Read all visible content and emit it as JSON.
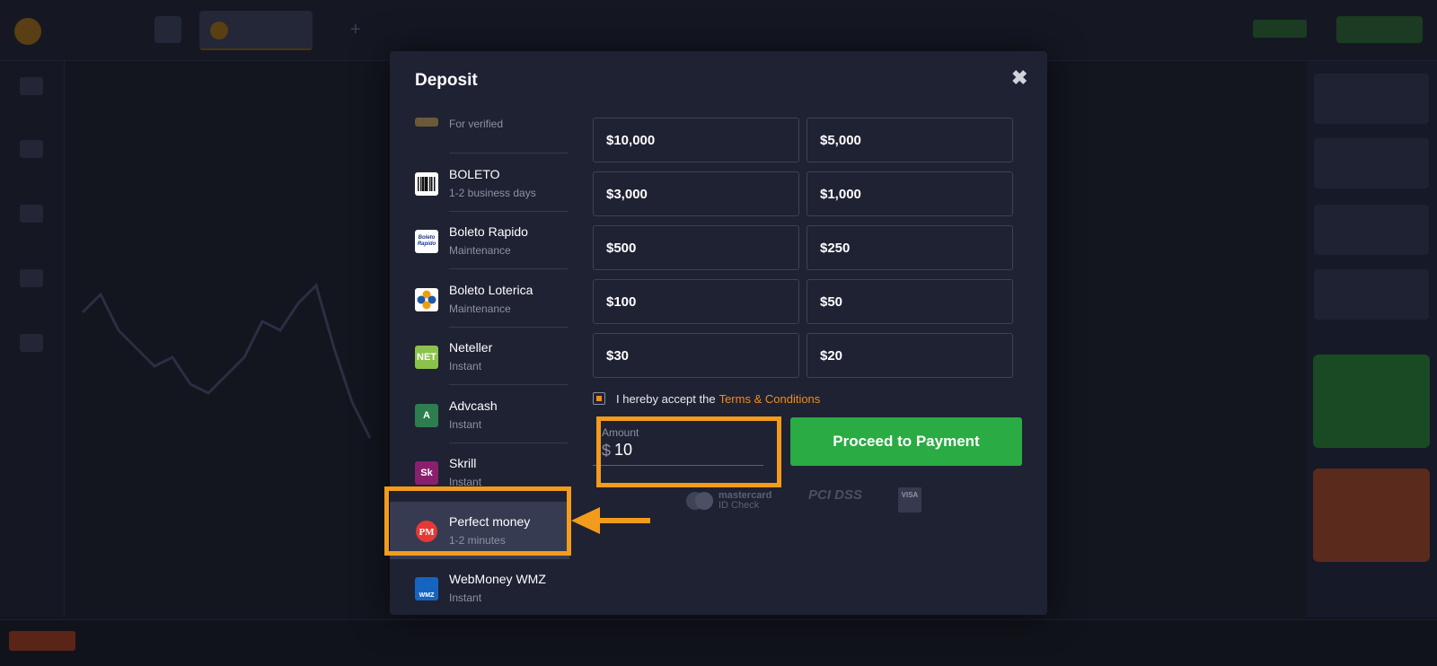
{
  "modal": {
    "title": "Deposit",
    "close_glyph": "✖"
  },
  "methods": [
    {
      "name": "",
      "sub": "For verified",
      "icon": "bank-card-icon",
      "icon_color": "#6b5a3a",
      "icon_text": ""
    },
    {
      "name": "BOLETO",
      "sub": "1-2 business days",
      "icon": "barcode-icon",
      "icon_color": "#ffffff",
      "icon_text": ""
    },
    {
      "name": "Boleto Rapido",
      "sub": "Maintenance",
      "icon": "boleto-rapido-icon",
      "icon_color": "#ffffff",
      "icon_text": "Boleto Rapido"
    },
    {
      "name": "Boleto Loterica",
      "sub": "Maintenance",
      "icon": "loterica-clover-icon",
      "icon_color": "#ffffff",
      "icon_text": ""
    },
    {
      "name": "Neteller",
      "sub": "Instant",
      "icon": "neteller-icon",
      "icon_color": "#8bc34a",
      "icon_text": "NET"
    },
    {
      "name": "Advcash",
      "sub": "Instant",
      "icon": "advcash-icon",
      "icon_color": "#2e7d4f",
      "icon_text": "A"
    },
    {
      "name": "Skrill",
      "sub": "Instant",
      "icon": "skrill-icon",
      "icon_color": "#8a1f6e",
      "icon_text": "Sk"
    },
    {
      "name": "Perfect money",
      "sub": "1-2 minutes",
      "icon": "perfect-money-icon",
      "icon_color": "#e53935",
      "icon_text": "PM",
      "selected": true
    },
    {
      "name": "WebMoney WMZ",
      "sub": "Instant",
      "icon": "webmoney-icon",
      "icon_color": "#1565c0",
      "icon_text": "WMZ"
    }
  ],
  "amounts": [
    "$10,000",
    "$5,000",
    "$3,000",
    "$1,000",
    "$500",
    "$250",
    "$100",
    "$50",
    "$30",
    "$20"
  ],
  "terms": {
    "checked": true,
    "text": "I hereby accept the",
    "link": "Terms & Conditions"
  },
  "amount_field": {
    "label": "Amount",
    "currency": "$",
    "value": "10"
  },
  "proceed_label": "Proceed to Payment",
  "payment_logos": {
    "mastercard": "mastercard\nID Check",
    "pci": "PCI DSS",
    "visa": "VISA"
  },
  "colors": {
    "accent": "#f18c19",
    "highlight": "#f29b1c",
    "proceed": "#2aab43",
    "modal_bg": "#1f2233"
  }
}
